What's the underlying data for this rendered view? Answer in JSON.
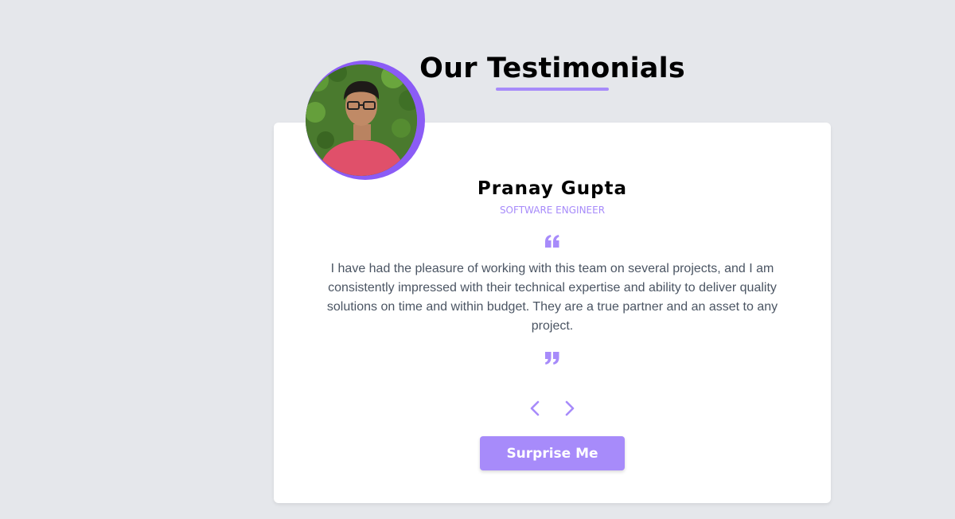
{
  "section": {
    "title": "Our Testimonials"
  },
  "testimonial": {
    "name": "Pranay Gupta",
    "role": "SOFTWARE ENGINEER",
    "quote": "I have had the pleasure of working with this team on several projects, and I am consistently impressed with their technical expertise and ability to deliver quality solutions on time and within budget. They are a true partner and an asset to any project."
  },
  "controls": {
    "prev_icon": "chevron-left-icon",
    "next_icon": "chevron-right-icon",
    "surprise_label": "Surprise Me"
  },
  "colors": {
    "accent": "#a78bfa",
    "accent_dark": "#8b5cf6",
    "background": "#e5e7eb",
    "card": "#ffffff",
    "body_text": "#4b5563"
  }
}
